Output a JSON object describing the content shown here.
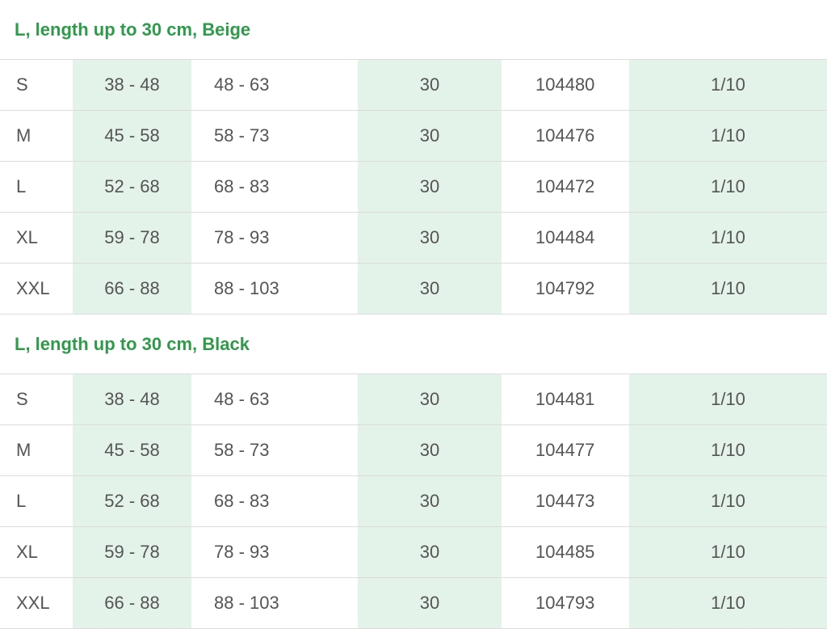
{
  "groups": [
    {
      "title": "L, length up to 30 cm, Beige",
      "rows": [
        {
          "size": "S",
          "range1": "38 - 48",
          "range2": "48 - 63",
          "length": "30",
          "article": "104480",
          "pack": "1/10"
        },
        {
          "size": "M",
          "range1": "45 - 58",
          "range2": "58 - 73",
          "length": "30",
          "article": "104476",
          "pack": "1/10"
        },
        {
          "size": "L",
          "range1": "52 - 68",
          "range2": "68 - 83",
          "length": "30",
          "article": "104472",
          "pack": "1/10"
        },
        {
          "size": "XL",
          "range1": "59 - 78",
          "range2": "78 - 93",
          "length": "30",
          "article": "104484",
          "pack": "1/10"
        },
        {
          "size": "XXL",
          "range1": "66 - 88",
          "range2": "88 - 103",
          "length": "30",
          "article": "104792",
          "pack": "1/10"
        }
      ]
    },
    {
      "title": "L, length up to 30 cm, Black",
      "rows": [
        {
          "size": "S",
          "range1": "38 - 48",
          "range2": "48 - 63",
          "length": "30",
          "article": "104481",
          "pack": "1/10"
        },
        {
          "size": "M",
          "range1": "45 - 58",
          "range2": "58 - 73",
          "length": "30",
          "article": "104477",
          "pack": "1/10"
        },
        {
          "size": "L",
          "range1": "52 - 68",
          "range2": "68 - 83",
          "length": "30",
          "article": "104473",
          "pack": "1/10"
        },
        {
          "size": "XL",
          "range1": "59 - 78",
          "range2": "78 - 93",
          "length": "30",
          "article": "104485",
          "pack": "1/10"
        },
        {
          "size": "XXL",
          "range1": "66 - 88",
          "range2": "88 - 103",
          "length": "30",
          "article": "104793",
          "pack": "1/10"
        }
      ]
    }
  ],
  "colors": {
    "header_text": "#2f9a4a",
    "shaded_column": "#e4f3e9",
    "row_border": "#dcdcdc",
    "cell_text": "#555555"
  }
}
